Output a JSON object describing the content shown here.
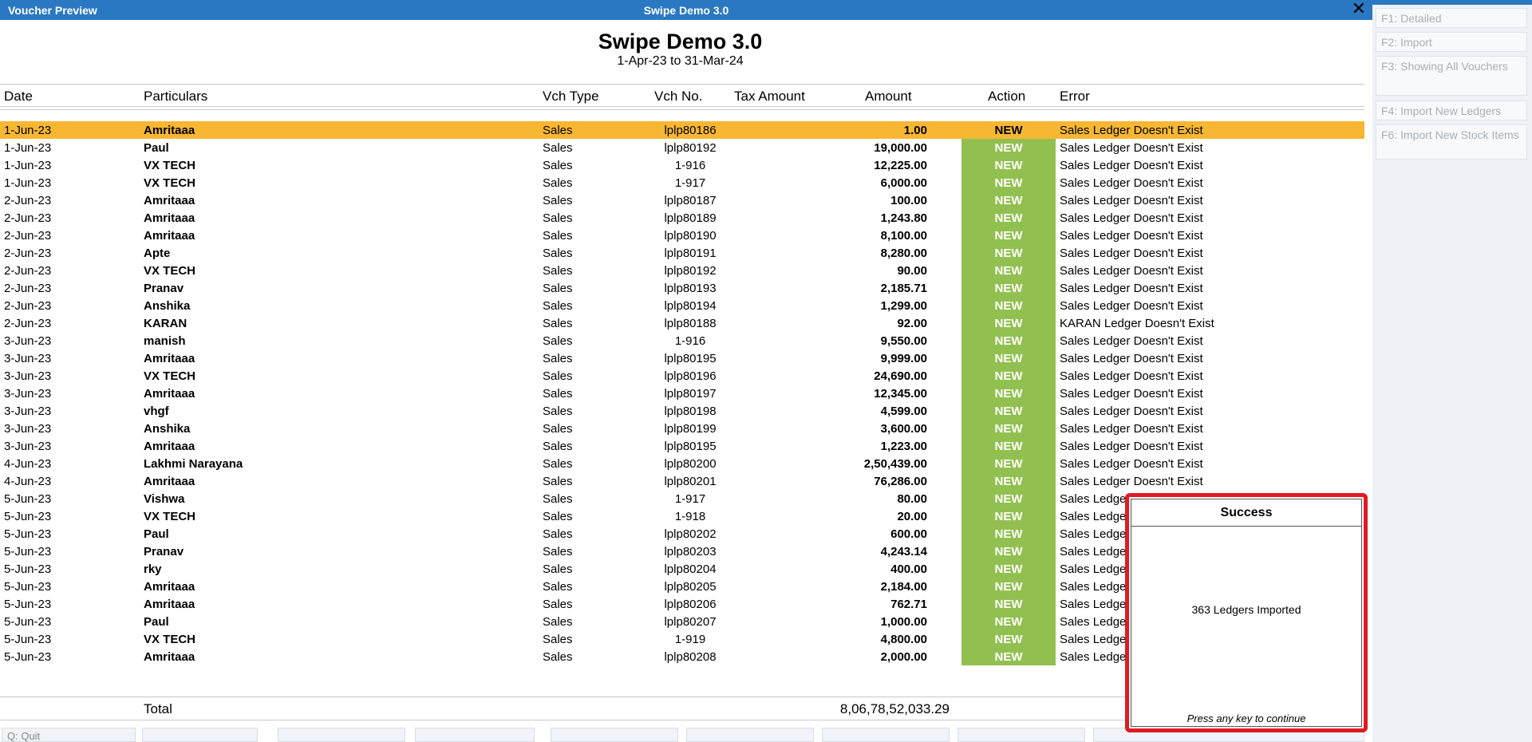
{
  "window": {
    "title_left": "Voucher Preview",
    "title_center": "Swipe Demo 3.0",
    "close_glyph": "✕"
  },
  "report": {
    "company": "Swipe Demo 3.0",
    "period": "1-Apr-23 to 31-Mar-24"
  },
  "columns": {
    "date": "Date",
    "particulars": "Particulars",
    "vch_type": "Vch Type",
    "vch_no": "Vch No.",
    "tax_amount": "Tax Amount",
    "amount": "Amount",
    "action": "Action",
    "error": "Error"
  },
  "rows": [
    {
      "date": "1-Jun-23",
      "particulars": "Amritaaa",
      "vch_type": "Sales",
      "vch_no": "lplp80186",
      "amount": "1.00",
      "action": "NEW",
      "error": "Sales Ledger Doesn't Exist",
      "selected": true
    },
    {
      "date": "1-Jun-23",
      "particulars": "Paul",
      "vch_type": "Sales",
      "vch_no": "lplp80192",
      "amount": "19,000.00",
      "action": "NEW",
      "error": "Sales Ledger Doesn't Exist"
    },
    {
      "date": "1-Jun-23",
      "particulars": "VX TECH",
      "vch_type": "Sales",
      "vch_no": "1-916",
      "amount": "12,225.00",
      "action": "NEW",
      "error": "Sales Ledger Doesn't Exist"
    },
    {
      "date": "1-Jun-23",
      "particulars": "VX TECH",
      "vch_type": "Sales",
      "vch_no": "1-917",
      "amount": "6,000.00",
      "action": "NEW",
      "error": "Sales Ledger Doesn't Exist"
    },
    {
      "date": "2-Jun-23",
      "particulars": "Amritaaa",
      "vch_type": "Sales",
      "vch_no": "lplp80187",
      "amount": "100.00",
      "action": "NEW",
      "error": "Sales Ledger Doesn't Exist"
    },
    {
      "date": "2-Jun-23",
      "particulars": "Amritaaa",
      "vch_type": "Sales",
      "vch_no": "lplp80189",
      "amount": "1,243.80",
      "action": "NEW",
      "error": "Sales Ledger Doesn't Exist"
    },
    {
      "date": "2-Jun-23",
      "particulars": "Amritaaa",
      "vch_type": "Sales",
      "vch_no": "lplp80190",
      "amount": "8,100.00",
      "action": "NEW",
      "error": "Sales Ledger Doesn't Exist"
    },
    {
      "date": "2-Jun-23",
      "particulars": "Apte",
      "vch_type": "Sales",
      "vch_no": "lplp80191",
      "amount": "8,280.00",
      "action": "NEW",
      "error": "Sales Ledger Doesn't Exist"
    },
    {
      "date": "2-Jun-23",
      "particulars": "VX TECH",
      "vch_type": "Sales",
      "vch_no": "lplp80192",
      "amount": "90.00",
      "action": "NEW",
      "error": "Sales Ledger Doesn't Exist"
    },
    {
      "date": "2-Jun-23",
      "particulars": "Pranav",
      "vch_type": "Sales",
      "vch_no": "lplp80193",
      "amount": "2,185.71",
      "action": "NEW",
      "error": "Sales Ledger Doesn't Exist"
    },
    {
      "date": "2-Jun-23",
      "particulars": "Anshika",
      "vch_type": "Sales",
      "vch_no": "lplp80194",
      "amount": "1,299.00",
      "action": "NEW",
      "error": "Sales Ledger Doesn't Exist"
    },
    {
      "date": "2-Jun-23",
      "particulars": "KARAN",
      "vch_type": "Sales",
      "vch_no": "lplp80188",
      "amount": "92.00",
      "action": "NEW",
      "error": "KARAN Ledger Doesn't Exist"
    },
    {
      "date": "3-Jun-23",
      "particulars": "manish",
      "vch_type": "Sales",
      "vch_no": "1-916",
      "amount": "9,550.00",
      "action": "NEW",
      "error": "Sales Ledger Doesn't Exist"
    },
    {
      "date": "3-Jun-23",
      "particulars": "Amritaaa",
      "vch_type": "Sales",
      "vch_no": "lplp80195",
      "amount": "9,999.00",
      "action": "NEW",
      "error": "Sales Ledger Doesn't Exist"
    },
    {
      "date": "3-Jun-23",
      "particulars": "VX TECH",
      "vch_type": "Sales",
      "vch_no": "lplp80196",
      "amount": "24,690.00",
      "action": "NEW",
      "error": "Sales Ledger Doesn't Exist"
    },
    {
      "date": "3-Jun-23",
      "particulars": "Amritaaa",
      "vch_type": "Sales",
      "vch_no": "lplp80197",
      "amount": "12,345.00",
      "action": "NEW",
      "error": "Sales Ledger Doesn't Exist"
    },
    {
      "date": "3-Jun-23",
      "particulars": "vhgf",
      "vch_type": "Sales",
      "vch_no": "lplp80198",
      "amount": "4,599.00",
      "action": "NEW",
      "error": "Sales Ledger Doesn't Exist"
    },
    {
      "date": "3-Jun-23",
      "particulars": "Anshika",
      "vch_type": "Sales",
      "vch_no": "lplp80199",
      "amount": "3,600.00",
      "action": "NEW",
      "error": "Sales Ledger Doesn't Exist"
    },
    {
      "date": "3-Jun-23",
      "particulars": "Amritaaa",
      "vch_type": "Sales",
      "vch_no": "lplp80195",
      "amount": "1,223.00",
      "action": "NEW",
      "error": "Sales Ledger Doesn't Exist"
    },
    {
      "date": "4-Jun-23",
      "particulars": "Lakhmi Narayana",
      "vch_type": "Sales",
      "vch_no": "lplp80200",
      "amount": "2,50,439.00",
      "action": "NEW",
      "error": "Sales Ledger Doesn't Exist"
    },
    {
      "date": "4-Jun-23",
      "particulars": "Amritaaa",
      "vch_type": "Sales",
      "vch_no": "lplp80201",
      "amount": "76,286.00",
      "action": "NEW",
      "error": "Sales Ledger Doesn't Exist"
    },
    {
      "date": "5-Jun-23",
      "particulars": "Vishwa",
      "vch_type": "Sales",
      "vch_no": "1-917",
      "amount": "80.00",
      "action": "NEW",
      "error": "Sales Ledger Doesn't Exist"
    },
    {
      "date": "5-Jun-23",
      "particulars": "VX TECH",
      "vch_type": "Sales",
      "vch_no": "1-918",
      "amount": "20.00",
      "action": "NEW",
      "error": "Sales Ledger Doesn't Exist"
    },
    {
      "date": "5-Jun-23",
      "particulars": "Paul",
      "vch_type": "Sales",
      "vch_no": "lplp80202",
      "amount": "600.00",
      "action": "NEW",
      "error": "Sales Ledger Doesn't Exist"
    },
    {
      "date": "5-Jun-23",
      "particulars": "Pranav",
      "vch_type": "Sales",
      "vch_no": "lplp80203",
      "amount": "4,243.14",
      "action": "NEW",
      "error": "Sales Ledger Doesn't Exist"
    },
    {
      "date": "5-Jun-23",
      "particulars": "rky",
      "vch_type": "Sales",
      "vch_no": "lplp80204",
      "amount": "400.00",
      "action": "NEW",
      "error": "Sales Ledger Doesn't Exist"
    },
    {
      "date": "5-Jun-23",
      "particulars": "Amritaaa",
      "vch_type": "Sales",
      "vch_no": "lplp80205",
      "amount": "2,184.00",
      "action": "NEW",
      "error": "Sales Ledger Doesn't Exist"
    },
    {
      "date": "5-Jun-23",
      "particulars": "Amritaaa",
      "vch_type": "Sales",
      "vch_no": "lplp80206",
      "amount": "762.71",
      "action": "NEW",
      "error": "Sales Ledger Doesn't Exist"
    },
    {
      "date": "5-Jun-23",
      "particulars": "Paul",
      "vch_type": "Sales",
      "vch_no": "lplp80207",
      "amount": "1,000.00",
      "action": "NEW",
      "error": "Sales Ledger Doesn't Exist"
    },
    {
      "date": "5-Jun-23",
      "particulars": "VX TECH",
      "vch_type": "Sales",
      "vch_no": "1-919",
      "amount": "4,800.00",
      "action": "NEW",
      "error": "Sales Ledger Doesn't Exist"
    },
    {
      "date": "5-Jun-23",
      "particulars": "Amritaaa",
      "vch_type": "Sales",
      "vch_no": "lplp80208",
      "amount": "2,000.00",
      "action": "NEW",
      "error": "Sales Ledger Doesn't Exist"
    }
  ],
  "total": {
    "label": "Total",
    "value": "8,06,78,52,033.29"
  },
  "sidebar": {
    "f1": {
      "key": "F1:",
      "label": "Detailed"
    },
    "f2": {
      "key": "F2:",
      "label": "Import"
    },
    "f3": {
      "key": "F3:",
      "label": "Showing All Vouchers"
    },
    "f4": {
      "key": "F4:",
      "label": "Import New Ledgers"
    },
    "f6": {
      "key": "F6:",
      "label": "Import New Stock Items"
    }
  },
  "bottombar": {
    "quit": "Q: Quit"
  },
  "dialog": {
    "title": "Success",
    "message": "363 Ledgers Imported",
    "footer": "Press any key to continue"
  }
}
